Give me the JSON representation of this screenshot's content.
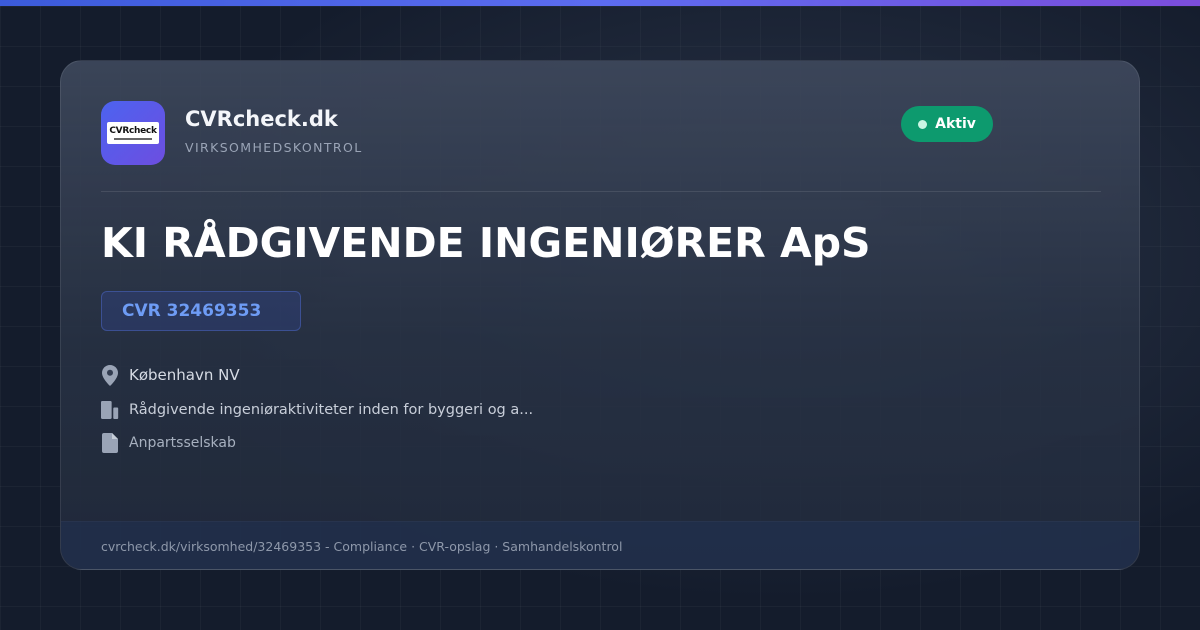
{
  "brand": {
    "logo_text": "CVRcheck",
    "name": "CVRcheck.dk",
    "tagline": "VIRKSOMHEDSKONTROL"
  },
  "status": {
    "label": "Aktiv",
    "color": "#0d9a6e"
  },
  "company": {
    "name": "KI RÅDGIVENDE INGENIØRER ApS",
    "cvr": "CVR 32469353",
    "location": "København NV",
    "industry": "Rådgivende ingeniøraktiviteter inden for byggeri og a...",
    "type": "Anpartsselskab"
  },
  "footer": {
    "text": "cvrcheck.dk/virksomhed/32469353 - Compliance · CVR-opslag · Samhandelskontrol"
  },
  "icons": {
    "location": "map-pin-icon",
    "industry": "building-icon",
    "type": "document-icon"
  },
  "colors": {
    "accent_top_bar": "#3b5bdb",
    "accent_purple": "#7c4ddc",
    "cvr_text": "#6e9cf5",
    "background": "#141c2c"
  }
}
